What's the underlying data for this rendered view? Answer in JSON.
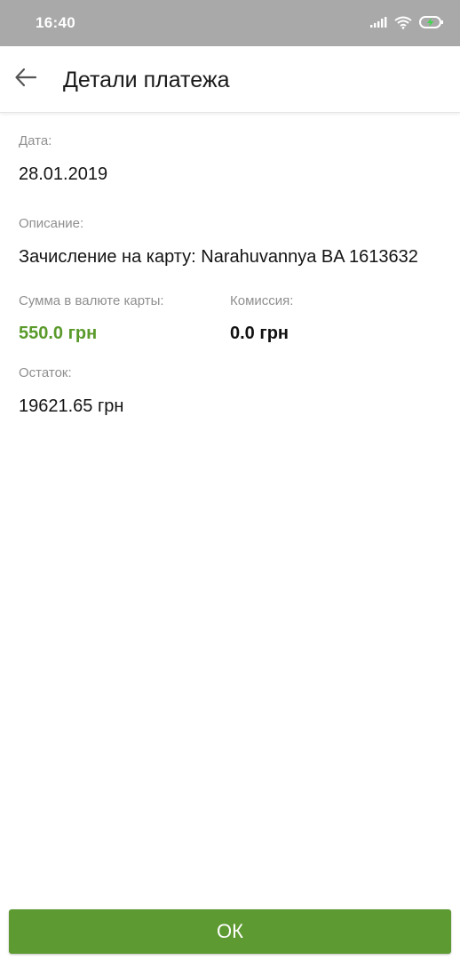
{
  "status_bar": {
    "time": "16:40",
    "icons": [
      "signal-icon",
      "wifi-icon",
      "battery-charging-icon"
    ]
  },
  "header": {
    "back_icon": "arrow-left-icon",
    "title": "Детали платежа"
  },
  "details": {
    "date": {
      "label": "Дата:",
      "value": "28.01.2019"
    },
    "description": {
      "label": "Описание:",
      "value": "Зачисление на карту: Narahuvannya BA 1613632"
    },
    "amount": {
      "label": "Сумма в валюте карты:",
      "value": "550.0 грн"
    },
    "fee": {
      "label": "Комиссия:",
      "value": "0.0 грн"
    },
    "balance": {
      "label": "Остаток:",
      "value": "19621.65 грн"
    }
  },
  "footer": {
    "ok_label": "ОК"
  },
  "colors": {
    "status_bar_bg": "#a9a9a9",
    "accent_green": "#5e9a32",
    "amount_green": "#5a9a2b",
    "label_gray": "#8f8f8f"
  }
}
